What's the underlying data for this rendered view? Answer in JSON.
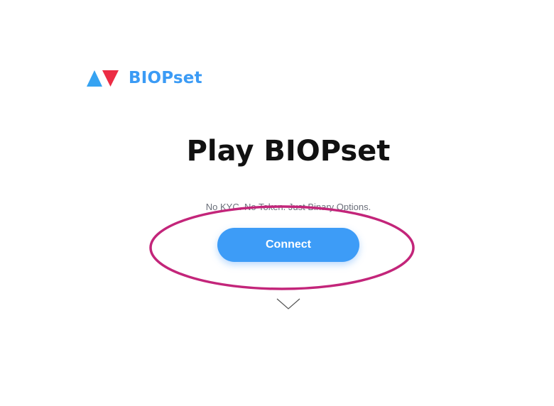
{
  "brand": {
    "name": "BIOPset",
    "logo_icon": "biopset-logo-icon",
    "color": "#3b9bf5",
    "logo_colors": {
      "blue": "#36a3f2",
      "red": "#ec2c44"
    }
  },
  "hero": {
    "title": "Play BIOPset",
    "tagline": "No KYC. No Token. Just Binary Options."
  },
  "actions": {
    "connect_label": "Connect",
    "connect_color": "#3d9cf7"
  },
  "annotation": {
    "highlight_color": "#c3257a"
  },
  "scroll_hint": {
    "icon": "chevron-down-icon"
  }
}
